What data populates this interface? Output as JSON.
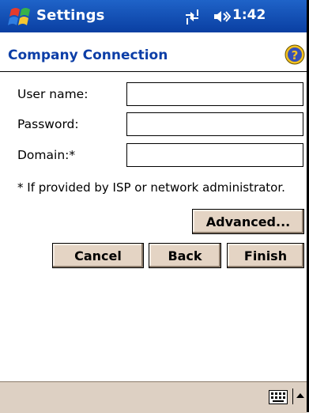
{
  "titlebar": {
    "app_title": "Settings",
    "clock": "1:42",
    "icons": [
      "start-flag-icon",
      "connectivity-icon",
      "volume-icon"
    ]
  },
  "page": {
    "title": "Company Connection",
    "help_icon": "help-icon"
  },
  "form": {
    "username_label": "User name:",
    "username_value": "",
    "password_label": "Password:",
    "password_value": "",
    "domain_label": "Domain:*",
    "domain_value": "",
    "note": "* If provided by ISP or network administrator."
  },
  "buttons": {
    "advanced": "Advanced...",
    "cancel": "Cancel",
    "back": "Back",
    "finish": "Finish"
  },
  "bottombar": {
    "icons": [
      "keyboard-icon",
      "sip-arrow-up-icon"
    ]
  },
  "colors": {
    "titlebar": "#1f63c8",
    "page_title": "#0c3ea7",
    "button_face": "#e4d4c4",
    "bottombar": "#ddd0c3"
  }
}
